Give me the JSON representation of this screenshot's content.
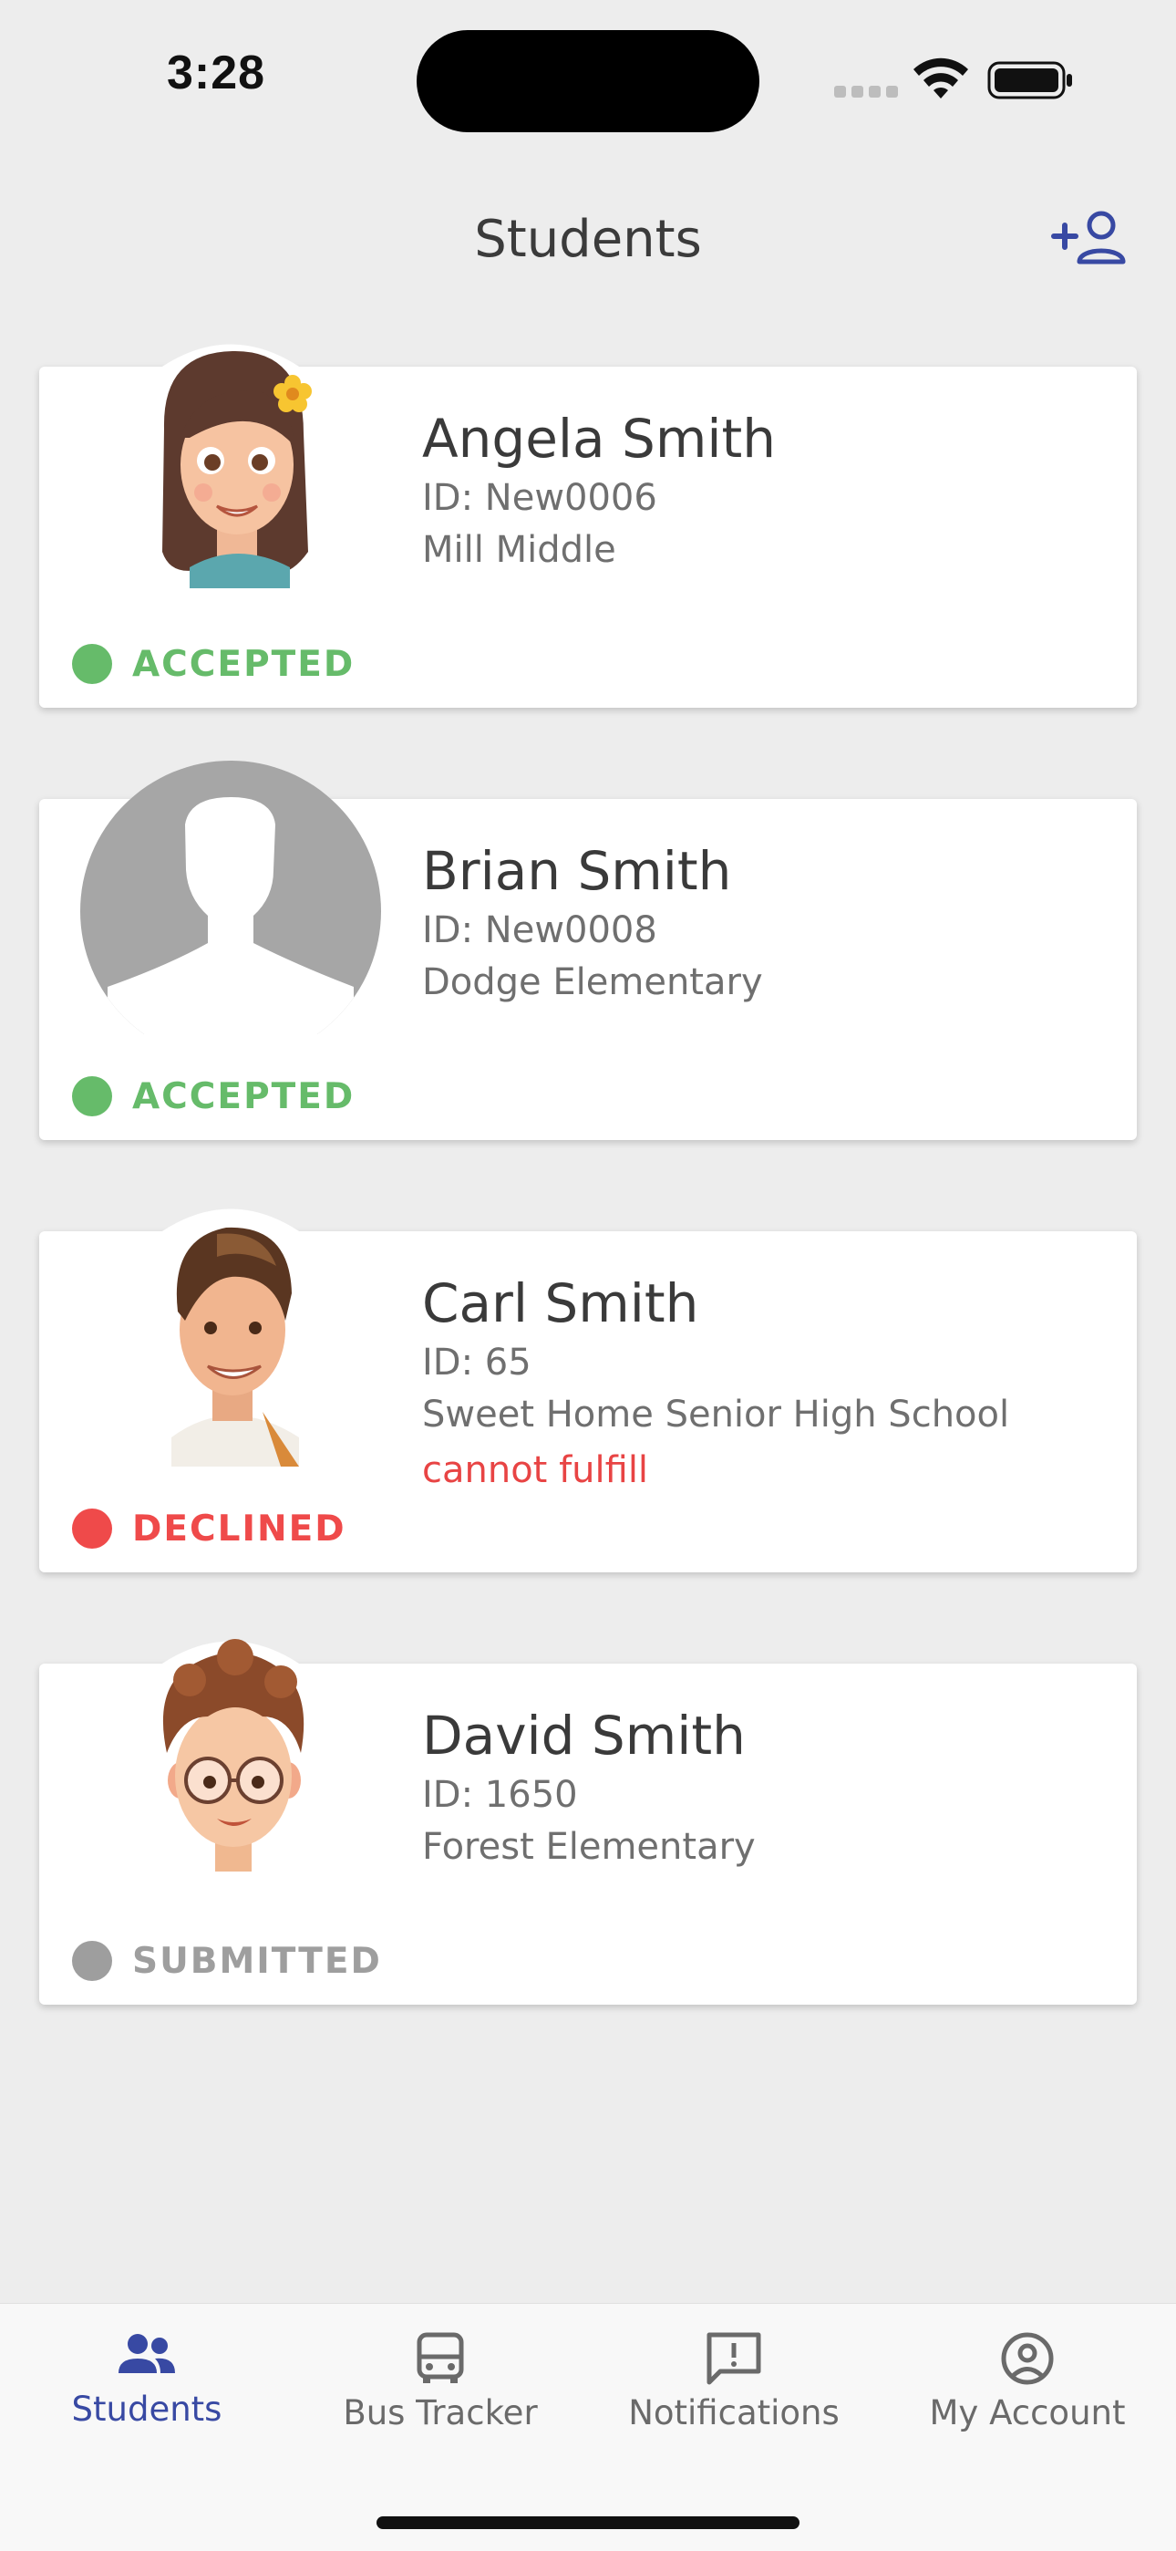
{
  "status_bar": {
    "time": "3:28"
  },
  "header": {
    "title": "Students",
    "add_icon": "add-person-icon"
  },
  "colors": {
    "accent": "#3849a3",
    "accepted": "#66bb6a",
    "declined": "#ef4a4a",
    "submitted": "#9e9e9e",
    "note": "#e84444"
  },
  "students": [
    {
      "name": "Angela Smith",
      "id": "ID: New0006",
      "school": "Mill Middle",
      "note": "",
      "status": "ACCEPTED",
      "avatar": "girl-avatar"
    },
    {
      "name": "Brian Smith",
      "id": "ID: New0008",
      "school": "Dodge Elementary",
      "note": "",
      "status": "ACCEPTED",
      "avatar": "placeholder-avatar"
    },
    {
      "name": "Carl Smith",
      "id": "ID: 65",
      "school": "Sweet Home Senior High School",
      "note": "cannot fulfill",
      "status": "DECLINED",
      "avatar": "man-avatar"
    },
    {
      "name": "David Smith",
      "id": "ID: 1650",
      "school": "Forest Elementary",
      "note": "",
      "status": "SUBMITTED",
      "avatar": "boy-glasses-avatar"
    }
  ],
  "tabs": [
    {
      "label": "Students",
      "icon": "people-icon",
      "active": true
    },
    {
      "label": "Bus Tracker",
      "icon": "bus-icon",
      "active": false
    },
    {
      "label": "Notifications",
      "icon": "alert-message-icon",
      "active": false
    },
    {
      "label": "My Account",
      "icon": "account-circle-icon",
      "active": false
    }
  ]
}
